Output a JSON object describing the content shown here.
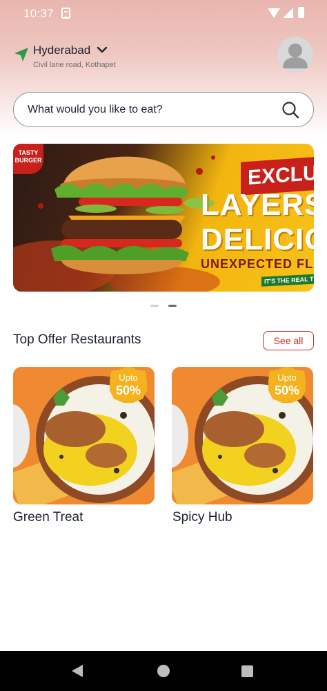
{
  "status_bar": {
    "time": "10:37",
    "icons": [
      "sim-icon",
      "wifi-icon",
      "signal-icon",
      "battery-icon"
    ]
  },
  "location": {
    "city": "Hyderabad",
    "address": "Civil lane road, Kothapet",
    "icon": "location-arrow-icon",
    "accent_color": "#2e9a4a"
  },
  "avatar": {
    "icon": "user-avatar-icon"
  },
  "search": {
    "placeholder": "What would you like to eat?",
    "value": "",
    "icon": "search-icon"
  },
  "banner": {
    "badge": "TASTY BURGER",
    "headline_top": "EXCLUSIVE",
    "headline_line1": "LAYERS OF",
    "headline_line2": "DELICIOUS",
    "headline_line3": "UNEXPECTED FLAVOR",
    "tagline": "IT'S THE REAL THING",
    "page_indicator": {
      "count": 2,
      "active": 2
    }
  },
  "section": {
    "title": "Top Offer Restaurants",
    "see_all_label": "See all",
    "accent_color": "#c62828"
  },
  "restaurants": [
    {
      "name": "Green Treat",
      "offer_prefix": "Upto",
      "offer_value": "50%"
    },
    {
      "name": "Spicy Hub",
      "offer_prefix": "Upto",
      "offer_value": "50%"
    }
  ],
  "nav_bar": {
    "icons": [
      "back-icon",
      "home-icon",
      "recents-icon"
    ]
  }
}
